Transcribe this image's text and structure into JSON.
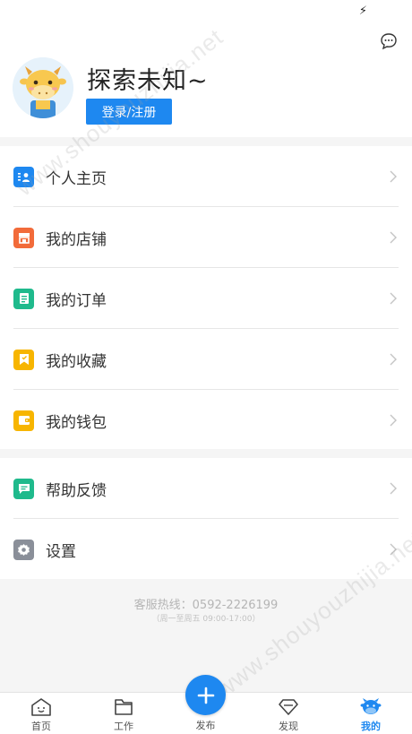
{
  "status_bar": {
    "icon": "charging-bolt-icon",
    "glyph": "⚡"
  },
  "profile": {
    "username": "探索未知~",
    "login_button": "登录/注册",
    "avatar_icon": "cow-avatar-icon",
    "message_icon": "message-bubble-icon"
  },
  "menu": {
    "group1": [
      {
        "label": "个人主页",
        "icon": "profile-card-icon",
        "color": "#1e88f0"
      },
      {
        "label": "我的店铺",
        "icon": "store-icon",
        "color": "#f26b3a"
      },
      {
        "label": "我的订单",
        "icon": "order-icon",
        "color": "#1fba8c"
      },
      {
        "label": "我的收藏",
        "icon": "bookmark-icon",
        "color": "#f7b500"
      },
      {
        "label": "我的钱包",
        "icon": "wallet-icon",
        "color": "#f7b500"
      }
    ],
    "group2": [
      {
        "label": "帮助反馈",
        "icon": "feedback-icon",
        "color": "#1fba8c"
      },
      {
        "label": "设置",
        "icon": "settings-gear-icon",
        "color": "#8a8f99"
      }
    ]
  },
  "footer": {
    "hotline": "客服热线：0592-2226199",
    "hours": "（周一至周五 09:00-17:00）"
  },
  "watermark": "www.shouyouzhijia.net",
  "tabs": [
    {
      "label": "首页",
      "icon": "home-face-icon",
      "active": false
    },
    {
      "label": "工作",
      "icon": "folder-icon",
      "active": false
    },
    {
      "label": "发布",
      "icon": "plus-icon",
      "active": false
    },
    {
      "label": "发现",
      "icon": "discover-diamond-icon",
      "active": false
    },
    {
      "label": "我的",
      "icon": "cow-mine-icon",
      "active": true
    }
  ],
  "colors": {
    "accent": "#1e88f0",
    "background": "#f5f5f5"
  }
}
